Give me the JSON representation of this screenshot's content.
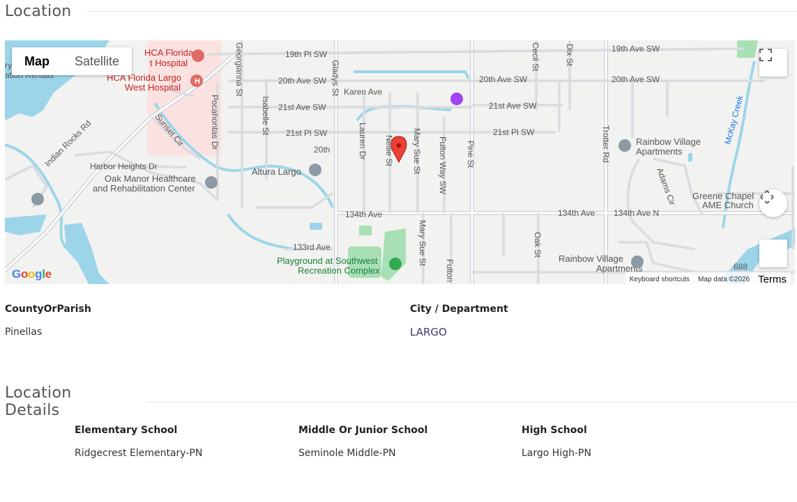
{
  "location_section": {
    "title": "Location"
  },
  "map": {
    "type_controls": {
      "map_label": "Map",
      "satellite_label": "Satellite"
    },
    "roads": {
      "r19th_pl_sw": "19th Pl SW",
      "r19th_ave_sw": "19th Ave SW",
      "r20th_ave_sw_a": "20th Ave SW",
      "r20th_ave_sw_b": "20th Ave SW",
      "r20th_ave_sw_c": "20th Ave SW",
      "karen_ave": "Karen Ave",
      "r21st_ave_sw_a": "21st Ave SW",
      "r21st_ave_sw_b": "21st Ave SW",
      "r21st_pl_sw_a": "21st Pl SW",
      "r21st_pl_sw_b": "21st Pl SW",
      "r20th_short": "20th",
      "indian_rocks": "Indian Rocks Rd",
      "sunset_cir": "Sunset Cir",
      "harbor_heights": "Harbor Heights Dr",
      "georgianna": "Georgianna St",
      "pocahontas": "Pocahontas Dr",
      "isabelle": "Isabelle St",
      "gladys": "Gladys St",
      "lauren": "Lauren Dr",
      "nellie": "Nellie St",
      "mary_sue_a": "Mary Sue St",
      "mary_sue_b": "Mary Sue St",
      "fulton_way": "Fulton Way SW",
      "fulton": "Fulton",
      "pine": "Pine St",
      "cecil": "Cecil St",
      "dix": "Dix St",
      "trotter": "Trotter Rd",
      "oak": "Oak St",
      "adams": "Adams Cir",
      "r134th_ave_a": "134th Ave",
      "r134th_ave_b": "134th Ave",
      "r134th_ave_n": "134th Ave N",
      "r133rd_ave": "133rd Ave",
      "mckay_creek": "McKay Creek",
      "route_688": "688",
      "partial_left_1": "ry",
      "partial_left_2": "ation Rentals"
    },
    "pois": {
      "hca_florida_1": "HCA Florida",
      "hca_florida_2": "t Hospital",
      "hca_largo_1": "HCA Florida Largo",
      "hca_largo_2": "West Hospital",
      "oak_manor_1": "Oak Manor Healthcare",
      "oak_manor_2": "and Rehabilitation Center",
      "altura": "Altura Largo",
      "rainbow_1a": "Rainbow Village",
      "rainbow_1b": "Apartments",
      "rainbow_2a": "Rainbow Village",
      "rainbow_2b": "Apartments",
      "greene_1": "Greene Chapel",
      "greene_2": "AME Church",
      "playground_1": "Playground at Southwest",
      "playground_2": "Recreation Complex"
    },
    "attribution": {
      "logo": "Google",
      "keyboard": "Keyboard shortcuts",
      "map_data": "Map data ©2026",
      "terms": "Terms"
    },
    "icons": {
      "marker": "map-pin-icon",
      "fullscreen": "fullscreen-icon",
      "pan": "pan-arrows-icon"
    },
    "colors": {
      "marker": "#ea4335",
      "water": "#9cd5ea",
      "park": "#a8dfb5",
      "hospital_area": "#fbe2e1"
    }
  },
  "location_fields": {
    "county_label": "CountyOrParish",
    "county_value": "Pinellas",
    "city_label": "City / Department",
    "city_value": "LARGO"
  },
  "details_section": {
    "title": "Location Details"
  },
  "schools": {
    "elementary_label": "Elementary School",
    "elementary_value": "Ridgecrest Elementary-PN",
    "middle_label": "Middle Or Junior School",
    "middle_value": "Seminole Middle-PN",
    "high_label": "High School",
    "high_value": "Largo High-PN"
  }
}
